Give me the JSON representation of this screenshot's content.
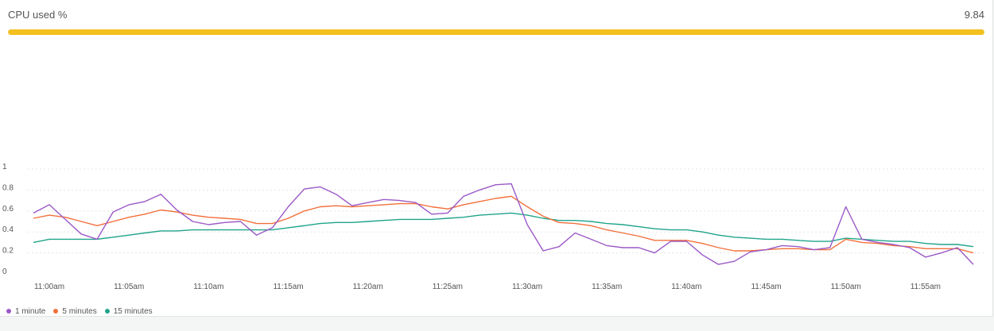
{
  "widget": {
    "title": "CPU used %",
    "value": "9.84",
    "bar_color": "#f3c01f",
    "bar_fraction": 1.0
  },
  "chart_data": {
    "type": "line",
    "ylim": [
      0,
      1
    ],
    "yticks": [
      "0",
      "0.2",
      "0.4",
      "0.6",
      "0.8",
      "1"
    ],
    "grid": true,
    "legend_position": "bottom-left",
    "xtick_labels": [
      "11:00am",
      "11:05am",
      "11:10am",
      "11:15am",
      "11:20am",
      "11:25am",
      "11:30am",
      "11:35am",
      "11:40am",
      "11:45am",
      "11:50am",
      "11:55am"
    ],
    "x_start": "10:59am",
    "x_step_minutes": 1,
    "series": [
      {
        "name": "1 minute",
        "color": "#9b59c7",
        "values": [
          0.58,
          0.66,
          0.52,
          0.38,
          0.33,
          0.59,
          0.66,
          0.69,
          0.76,
          0.61,
          0.5,
          0.47,
          0.49,
          0.5,
          0.37,
          0.44,
          0.64,
          0.81,
          0.83,
          0.76,
          0.65,
          0.68,
          0.71,
          0.7,
          0.68,
          0.57,
          0.58,
          0.74,
          0.8,
          0.85,
          0.86,
          0.47,
          0.22,
          0.26,
          0.39,
          0.33,
          0.27,
          0.25,
          0.25,
          0.2,
          0.31,
          0.31,
          0.18,
          0.09,
          0.12,
          0.21,
          0.23,
          0.27,
          0.26,
          0.23,
          0.25,
          0.64,
          0.33,
          0.3,
          0.28,
          0.25,
          0.16,
          0.2,
          0.25,
          0.09
        ]
      },
      {
        "name": "5 minutes",
        "color": "#f2703b",
        "values": [
          0.53,
          0.56,
          0.54,
          0.5,
          0.46,
          0.5,
          0.54,
          0.57,
          0.61,
          0.59,
          0.56,
          0.54,
          0.53,
          0.52,
          0.48,
          0.48,
          0.53,
          0.6,
          0.64,
          0.65,
          0.64,
          0.65,
          0.66,
          0.67,
          0.67,
          0.64,
          0.62,
          0.66,
          0.69,
          0.72,
          0.74,
          0.64,
          0.55,
          0.49,
          0.48,
          0.46,
          0.42,
          0.39,
          0.36,
          0.32,
          0.32,
          0.32,
          0.29,
          0.25,
          0.22,
          0.22,
          0.23,
          0.24,
          0.24,
          0.23,
          0.23,
          0.33,
          0.3,
          0.29,
          0.27,
          0.26,
          0.24,
          0.24,
          0.24,
          0.2
        ]
      },
      {
        "name": "15 minutes",
        "color": "#20a48a",
        "values": [
          0.3,
          0.33,
          0.33,
          0.33,
          0.33,
          0.35,
          0.37,
          0.39,
          0.41,
          0.41,
          0.42,
          0.42,
          0.42,
          0.42,
          0.42,
          0.42,
          0.44,
          0.46,
          0.48,
          0.49,
          0.49,
          0.5,
          0.51,
          0.52,
          0.52,
          0.52,
          0.53,
          0.54,
          0.56,
          0.57,
          0.58,
          0.56,
          0.53,
          0.51,
          0.51,
          0.5,
          0.48,
          0.47,
          0.45,
          0.43,
          0.42,
          0.42,
          0.4,
          0.37,
          0.35,
          0.34,
          0.33,
          0.33,
          0.32,
          0.31,
          0.31,
          0.34,
          0.33,
          0.32,
          0.31,
          0.31,
          0.29,
          0.28,
          0.28,
          0.26
        ]
      }
    ]
  }
}
